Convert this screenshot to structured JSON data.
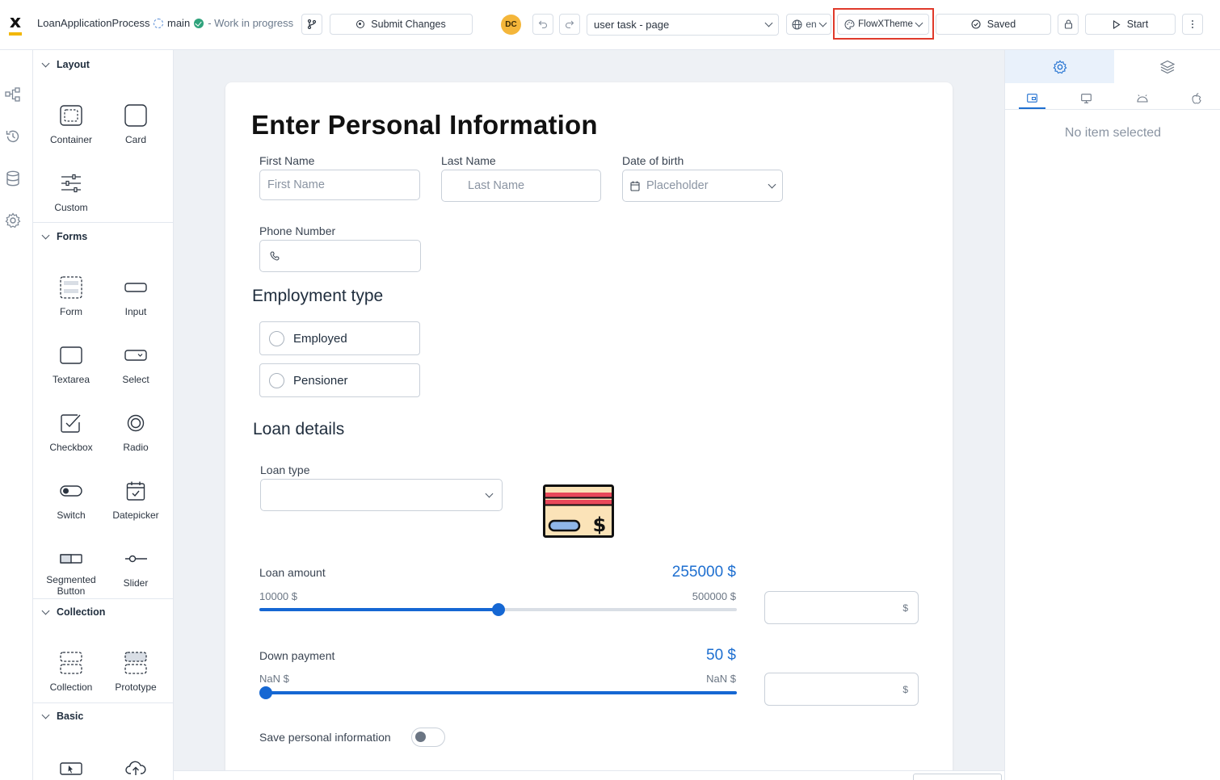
{
  "topbar": {
    "process_name": "LoanApplicationProcess",
    "branch": "main",
    "branch_status": "- Work in progress",
    "submit_label": "Submit Changes",
    "avatar_initials": "DC",
    "page_select": "user task - page",
    "language": "en",
    "theme": "FlowXTheme",
    "saved_label": "Saved",
    "start_label": "Start"
  },
  "components": {
    "sections": [
      {
        "title": "Layout",
        "items": [
          "Container",
          "Card",
          "Custom"
        ]
      },
      {
        "title": "Forms",
        "items": [
          "Form",
          "Input",
          "Textarea",
          "Select",
          "Checkbox",
          "Radio",
          "Switch",
          "Datepicker",
          "Segmented Button",
          "Slider"
        ]
      },
      {
        "title": "Collection",
        "items": [
          "Collection",
          "Prototype"
        ]
      },
      {
        "title": "Basic",
        "items": []
      }
    ],
    "segmented_line1": "Segmented",
    "segmented_line2": "Button"
  },
  "form": {
    "title": "Enter Personal Information",
    "first_name": {
      "label": "First Name",
      "placeholder": "First Name"
    },
    "last_name": {
      "label": "Last Name",
      "placeholder": "Last Name"
    },
    "dob": {
      "label": "Date of birth",
      "placeholder": "Placeholder"
    },
    "phone": {
      "label": "Phone Number"
    },
    "employment_title": "Employment type",
    "employment_options": [
      "Employed",
      "Pensioner"
    ],
    "loan_title": "Loan details",
    "loan_type": {
      "label": "Loan type"
    },
    "loan_amount": {
      "label": "Loan amount",
      "value": "255000 $",
      "min": "10000 $",
      "max": "500000 $",
      "position": 0.5,
      "unit": "$"
    },
    "down_payment": {
      "label": "Down payment",
      "value": "50 $",
      "min": "NaN $",
      "max": "NaN $",
      "position": 0.0,
      "unit": "$"
    },
    "save_info": {
      "label": "Save personal information",
      "on": false
    }
  },
  "right_panel": {
    "empty_text": "No item selected"
  },
  "colors": {
    "accent": "#1e6fd0",
    "highlight": "#e03a2b",
    "logo_bar": "#f2b705",
    "avatar": "#f4b63a"
  }
}
